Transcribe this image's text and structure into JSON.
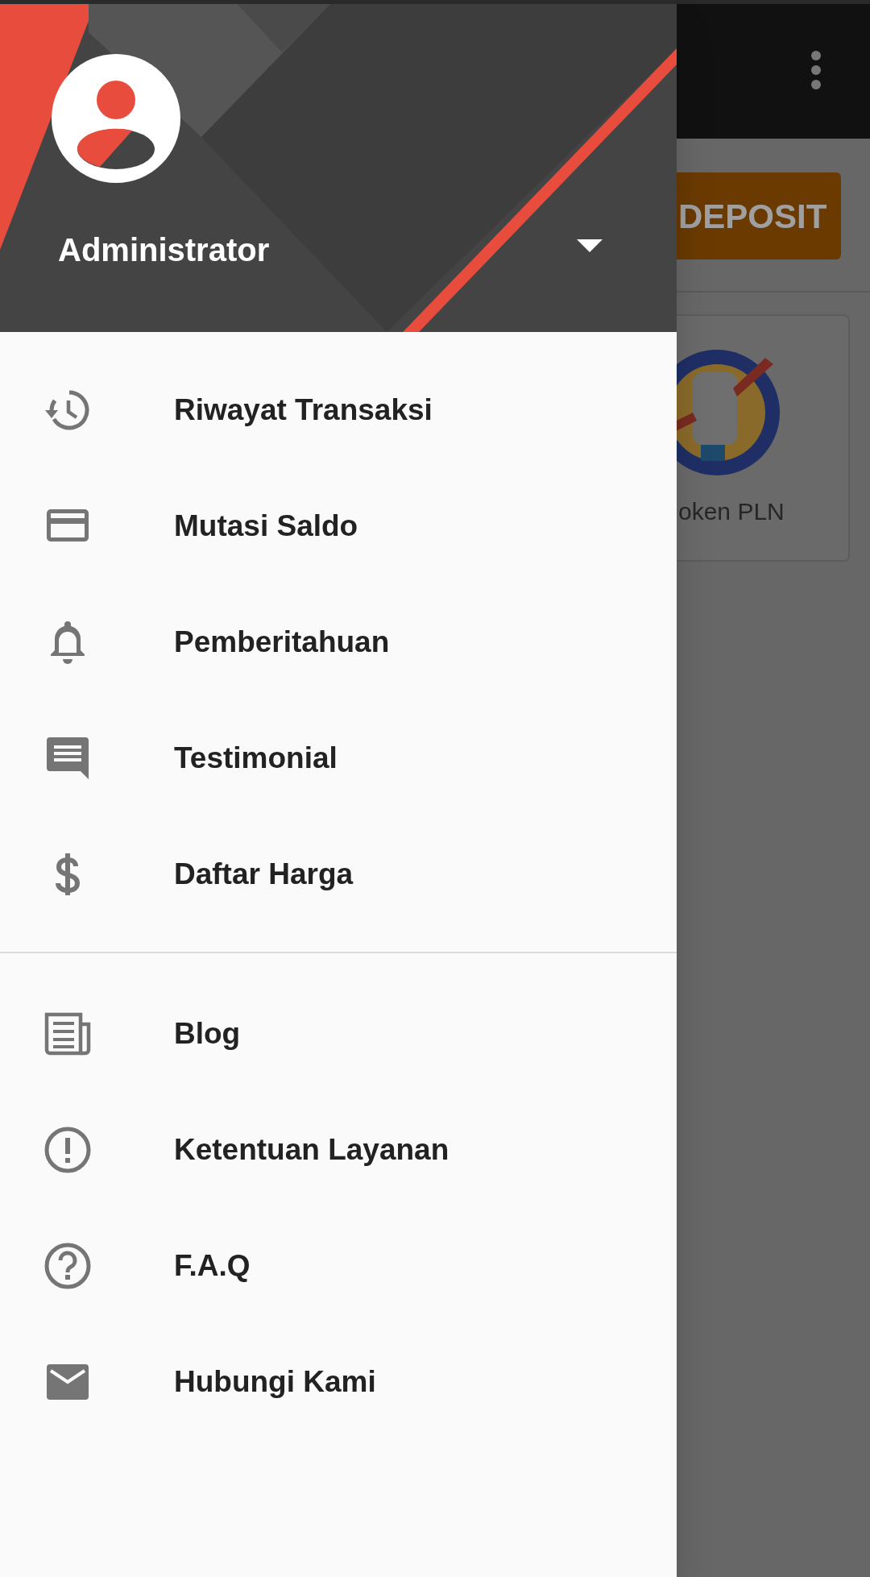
{
  "background_app": {
    "deposit_button": "DEPOSIT",
    "product_card": {
      "label": "oken PLN"
    }
  },
  "drawer": {
    "account": {
      "name": "Administrator",
      "expanded": false
    },
    "groups": [
      {
        "items": [
          {
            "label": "Riwayat Transaksi"
          },
          {
            "label": "Mutasi Saldo"
          },
          {
            "label": "Pemberitahuan"
          },
          {
            "label": "Testimonial"
          },
          {
            "label": "Daftar Harga"
          }
        ]
      },
      {
        "items": [
          {
            "label": "Blog"
          },
          {
            "label": "Ketentuan Layanan"
          },
          {
            "label": "F.A.Q"
          },
          {
            "label": "Hubungi Kami"
          }
        ]
      }
    ]
  }
}
